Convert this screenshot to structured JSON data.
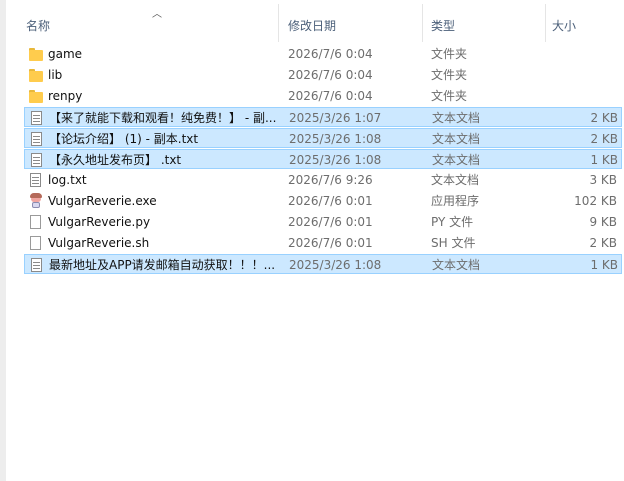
{
  "header": {
    "name_label": "名称",
    "date_label": "修改日期",
    "type_label": "类型",
    "size_label": "大小"
  },
  "files": [
    {
      "name": "game",
      "date": "2026/7/6 0:04",
      "type": "文件夹",
      "size": "",
      "icon": "folder-icon",
      "selected": false
    },
    {
      "name": "lib",
      "date": "2026/7/6 0:04",
      "type": "文件夹",
      "size": "",
      "icon": "folder-icon",
      "selected": false
    },
    {
      "name": "renpy",
      "date": "2026/7/6 0:04",
      "type": "文件夹",
      "size": "",
      "icon": "folder-icon",
      "selected": false
    },
    {
      "name": "【来了就能下载和观看！纯免费！】 - 副...",
      "date": "2025/3/26 1:07",
      "type": "文本文档",
      "size": "2 KB",
      "icon": "text-document-icon",
      "selected": true
    },
    {
      "name": "【论坛介绍】 (1) - 副本.txt",
      "date": "2025/3/26 1:08",
      "type": "文本文档",
      "size": "2 KB",
      "icon": "text-document-icon",
      "selected": true
    },
    {
      "name": "【永久地址发布页】 .txt",
      "date": "2025/3/26 1:08",
      "type": "文本文档",
      "size": "1 KB",
      "icon": "text-document-icon",
      "selected": true
    },
    {
      "name": "log.txt",
      "date": "2026/7/6 9:26",
      "type": "文本文档",
      "size": "3 KB",
      "icon": "text-document-icon",
      "selected": false
    },
    {
      "name": "VulgarReverie.exe",
      "date": "2026/7/6 0:01",
      "type": "应用程序",
      "size": "102 KB",
      "icon": "application-icon",
      "selected": false
    },
    {
      "name": "VulgarReverie.py",
      "date": "2026/7/6 0:01",
      "type": "PY 文件",
      "size": "9 KB",
      "icon": "blank-file-icon",
      "selected": false
    },
    {
      "name": "VulgarReverie.sh",
      "date": "2026/7/6 0:01",
      "type": "SH 文件",
      "size": "2 KB",
      "icon": "blank-file-icon",
      "selected": false
    },
    {
      "name": "最新地址及APP请发邮箱自动获取！！！...",
      "date": "2025/3/26 1:08",
      "type": "文本文档",
      "size": "1 KB",
      "icon": "text-document-icon",
      "selected": true
    }
  ]
}
